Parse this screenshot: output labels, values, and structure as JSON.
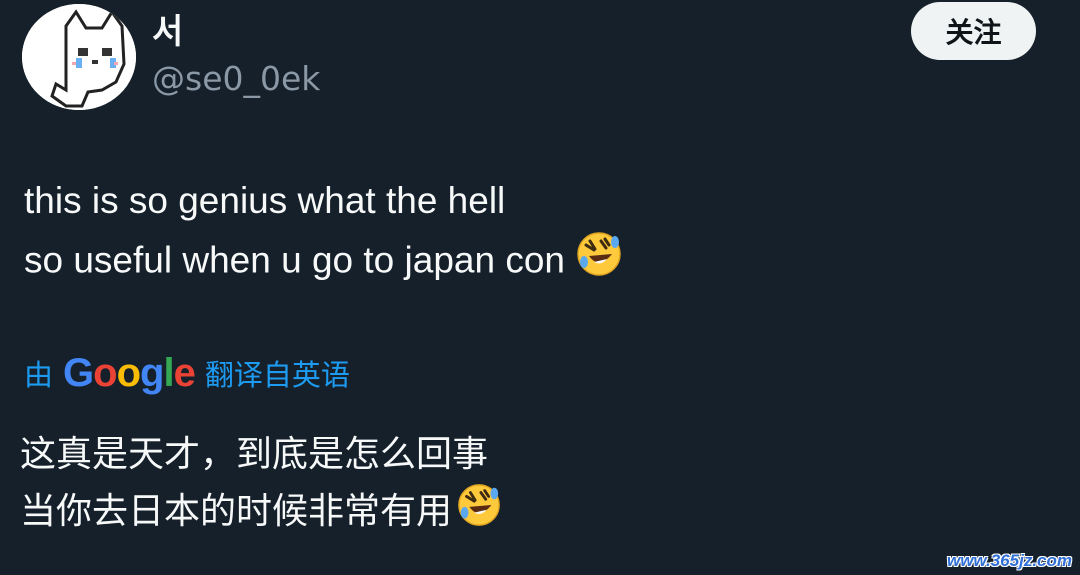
{
  "user": {
    "display_name": "서",
    "handle": "@se0_0ek",
    "avatar_icon": "crying-cat-pixel-icon"
  },
  "header": {
    "follow_label": "关注"
  },
  "tweet": {
    "line1": "this is so genius what the hell",
    "line2": "so useful when u go to japan con",
    "emoji_icon": "rolling-on-floor-laughing-emoji"
  },
  "translation": {
    "prefix": "由",
    "brand": "Google",
    "suffix": "翻译自英语",
    "line1": "这真是天才，到底是怎么回事",
    "line2": "当你去日本的时候非常有用"
  },
  "watermark": "www.365jz.com",
  "colors": {
    "background": "#15202b",
    "text_primary": "#f7f9f9",
    "text_secondary": "#8b98a5",
    "link": "#1d9bf0",
    "button_bg": "#eff3f4"
  }
}
